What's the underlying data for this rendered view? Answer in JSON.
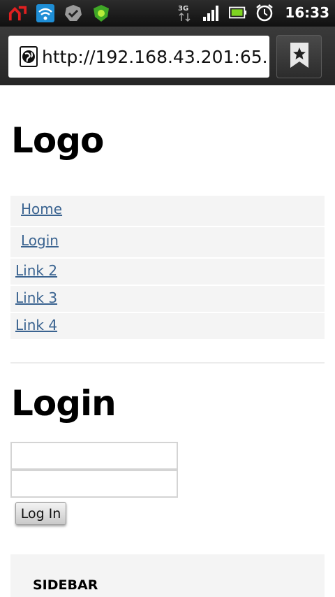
{
  "status_bar": {
    "icons": [
      "upload-arrow-icon",
      "wifi-icon",
      "checkmark-badge-icon",
      "leaf-shield-icon",
      "3g-data-icon",
      "signal-icon",
      "battery-icon",
      "alarm-icon"
    ],
    "network_label": "3G",
    "time": "16:33"
  },
  "browser": {
    "url": "http://192.168.43.201:65...",
    "bookmark_icon": "bookmark-star-icon"
  },
  "page": {
    "logo": "Logo",
    "nav": [
      {
        "label": "Home"
      },
      {
        "label": "Login"
      },
      {
        "label": "Link 2"
      },
      {
        "label": "Link 3"
      },
      {
        "label": "Link 4"
      }
    ],
    "login_heading": "Login",
    "username_value": "",
    "password_value": "",
    "login_button": "Log In",
    "sidebar_title": "SIDEBAR"
  },
  "colors": {
    "link": "#3a6390",
    "nav_background": "#f4f4f4",
    "status_bar": "#1a1a1a"
  }
}
